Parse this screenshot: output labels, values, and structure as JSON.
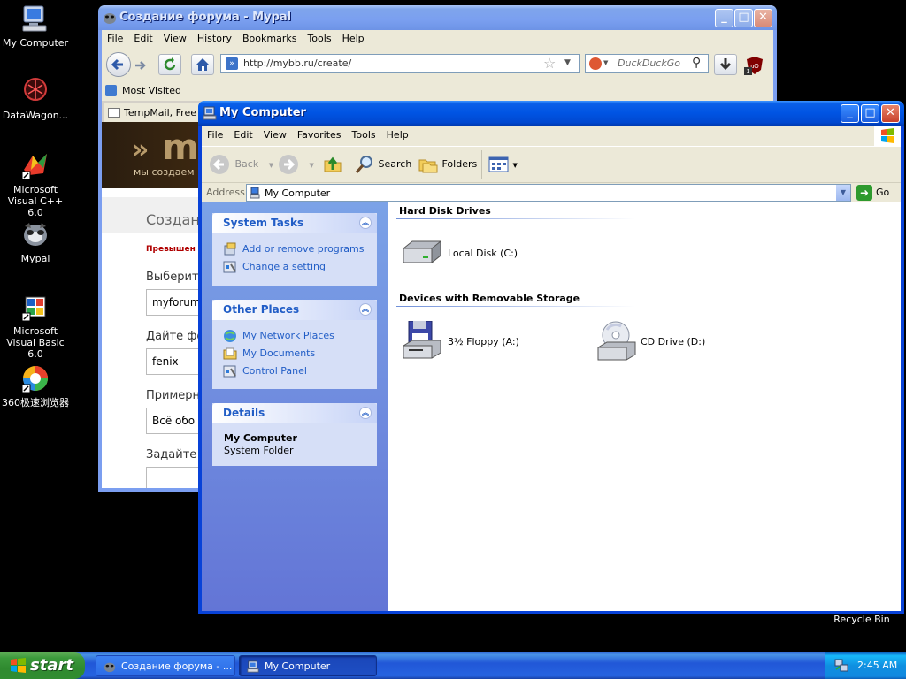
{
  "desktop": {
    "icons": [
      {
        "label": "My Computer",
        "icon": "my-computer-icon"
      },
      {
        "label": "DataWagon...",
        "icon": "datawagon-icon"
      },
      {
        "label": "Microsoft Visual C++ 6.0",
        "icon": "visual-cpp-icon"
      },
      {
        "label": "Mypal",
        "icon": "mypal-icon"
      },
      {
        "label": "Microsoft Visual Basic 6.0",
        "icon": "visual-basic-icon"
      },
      {
        "label": "360极速浏览器",
        "icon": "browser-360-icon"
      }
    ],
    "recycle_bin": "Recycle Bin"
  },
  "browser": {
    "title": "Создание форума - Mypal",
    "menu": [
      "File",
      "Edit",
      "View",
      "History",
      "Bookmarks",
      "Tools",
      "Help"
    ],
    "url": "http://mybb.ru/create/",
    "search_placeholder": "DuckDuckGo",
    "bookmarks_label": "Most Visited",
    "tab_label": "TempMail, Free Te",
    "banner_text": "мы создаем",
    "banner_letter": "m",
    "page": {
      "heading": "Создани",
      "warning": "Превышен л",
      "label1": "Выберите",
      "input1": "myforum",
      "label2": "Дайте фо",
      "input2": "fenix",
      "label3": "Примерна",
      "input3": "Всё обо",
      "label4": "Задайте"
    }
  },
  "explorer": {
    "title": "My Computer",
    "menu": [
      "File",
      "Edit",
      "View",
      "Favorites",
      "Tools",
      "Help"
    ],
    "toolbar": {
      "back": "Back",
      "search": "Search",
      "folders": "Folders"
    },
    "address_label": "Address",
    "address_value": "My Computer",
    "go_label": "Go",
    "panels": {
      "system_tasks": {
        "title": "System Tasks",
        "items": [
          "Add or remove programs",
          "Change a setting"
        ]
      },
      "other_places": {
        "title": "Other Places",
        "items": [
          "My Network Places",
          "My Documents",
          "Control Panel"
        ]
      },
      "details": {
        "title": "Details",
        "name": "My Computer",
        "type": "System Folder"
      }
    },
    "groups": {
      "hard_disks": {
        "title": "Hard Disk Drives",
        "items": [
          "Local Disk (C:)"
        ]
      },
      "removable": {
        "title": "Devices with Removable Storage",
        "items": [
          "3½ Floppy (A:)",
          "CD Drive (D:)"
        ]
      }
    }
  },
  "taskbar": {
    "start_label": "start",
    "buttons": [
      "Создание форума - ...",
      "My Computer"
    ],
    "clock": "2:45 AM"
  }
}
